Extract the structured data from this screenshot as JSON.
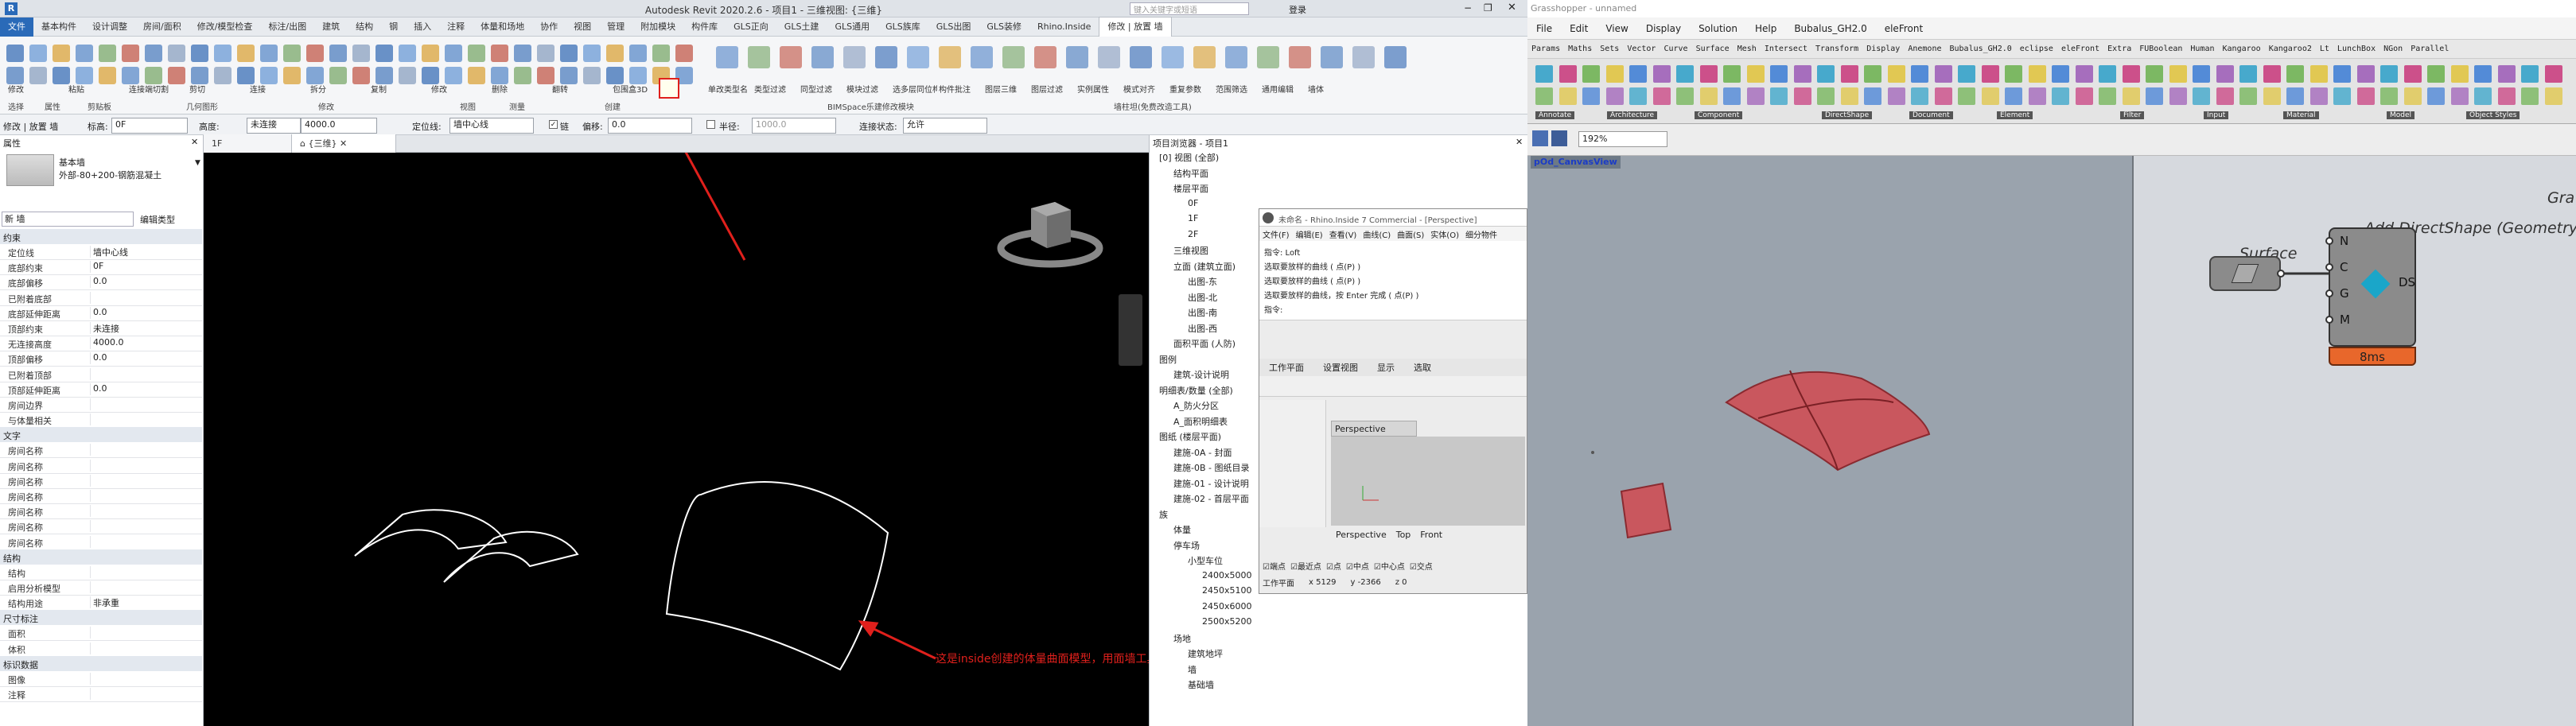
{
  "revit": {
    "title": "Autodesk Revit 2020.2.6 - 项目1 - 三维视图: {三维}",
    "search_placeholder": "键入关键字或短语",
    "user": "登录",
    "tabs": [
      "文件",
      "基本构件",
      "设计调整",
      "房间/面积",
      "修改/模型检查",
      "标注/出图",
      "建筑",
      "结构",
      "钢",
      "插入",
      "注释",
      "体量和场地",
      "协作",
      "视图",
      "管理",
      "附加模块",
      "构件库",
      "GLS正向",
      "GLS土建",
      "GLS通用",
      "GLS族库",
      "GLS出图",
      "GLS装修",
      "Rhino.Inside",
      "修改 | 放置 墙"
    ],
    "ribbon_groups": [
      "选择",
      "属性",
      "剪贴板",
      "几何图形",
      "修改",
      "视图",
      "测量",
      "创建",
      "BIMSpace乐建修改模块",
      "墙柱坦(免费改造工具)"
    ],
    "ribbon_labels": [
      "修改",
      "粘贴",
      "连接端切割",
      "剪切",
      "连接",
      "拆分",
      "复制",
      "修改",
      "删除",
      "翻转",
      "包围盒3D",
      "单改类型名",
      "类型过滤",
      "同型过滤",
      "模块过滤",
      "选多层同位构件",
      "构件批注",
      "图层三维",
      "图层过滤",
      "实例属性",
      "模式对齐",
      "重复参数",
      "范围筛选",
      "通用编辑",
      "墙体"
    ],
    "options": {
      "mode_label": "修改 | 放置 墙",
      "height_label": "高度:",
      "height_value": "未连接",
      "height_num": "4000.0",
      "locline_label": "定位线:",
      "locline_value": "墙中心线",
      "chain_label": "链",
      "offset_label": "偏移:",
      "offset_value": "0.0",
      "radius_label": "半径:",
      "radius_value": "1000.0",
      "join_label": "连接状态:",
      "join_value": "允许",
      "level_label": "标高:",
      "level_value": "0F"
    },
    "properties": {
      "header": "属性",
      "type_name": "基本墙",
      "type_sub": "外部-80+200-钢筋混凝土",
      "instance_filter": "新 墙",
      "edit_type": "编辑类型",
      "sections": [
        {
          "name": "约束",
          "rows": [
            [
              "定位线",
              "墙中心线"
            ],
            [
              "底部约束",
              "0F"
            ],
            [
              "底部偏移",
              "0.0"
            ],
            [
              "已附着底部",
              ""
            ],
            [
              "底部延伸距离",
              "0.0"
            ],
            [
              "顶部约束",
              "未连接"
            ],
            [
              "无连接高度",
              "4000.0"
            ],
            [
              "顶部偏移",
              "0.0"
            ],
            [
              "已附着顶部",
              ""
            ],
            [
              "顶部延伸距离",
              "0.0"
            ],
            [
              "房间边界",
              ""
            ],
            [
              "与体量相关",
              ""
            ]
          ]
        },
        {
          "name": "文字",
          "rows": [
            [
              "房间名称",
              ""
            ],
            [
              "房间名称",
              ""
            ],
            [
              "房间名称",
              ""
            ],
            [
              "房间名称",
              ""
            ],
            [
              "房间名称",
              ""
            ],
            [
              "房间名称",
              ""
            ],
            [
              "房间名称",
              ""
            ]
          ]
        },
        {
          "name": "结构",
          "rows": [
            [
              "结构",
              ""
            ],
            [
              "启用分析模型",
              ""
            ],
            [
              "结构用途",
              "非承重"
            ]
          ]
        },
        {
          "name": "尺寸标注",
          "rows": [
            [
              "面积",
              ""
            ],
            [
              "体积",
              ""
            ]
          ]
        },
        {
          "name": "标识数据",
          "rows": [
            [
              "图像",
              ""
            ],
            [
              "注释",
              ""
            ]
          ]
        }
      ]
    },
    "view_tabs": [
      "1F",
      "{三维}"
    ],
    "annotation": "这是inside创建的体量曲面模型，用面墙工具无法拾取生成为墙体",
    "browser": {
      "title": "项目浏览器 - 项目1",
      "items": [
        {
          "t": "[0] 视图 (全部)",
          "d": 0
        },
        {
          "t": "结构平面",
          "d": 1
        },
        {
          "t": "楼层平面",
          "d": 1
        },
        {
          "t": "0F",
          "d": 2
        },
        {
          "t": "1F",
          "d": 2
        },
        {
          "t": "2F",
          "d": 2
        },
        {
          "t": "三维视图",
          "d": 1
        },
        {
          "t": "立面 (建筑立面)",
          "d": 1
        },
        {
          "t": "出图-东",
          "d": 2
        },
        {
          "t": "出图-北",
          "d": 2
        },
        {
          "t": "出图-南",
          "d": 2
        },
        {
          "t": "出图-西",
          "d": 2
        },
        {
          "t": "面积平面 (人防)",
          "d": 1
        },
        {
          "t": "图例",
          "d": 0
        },
        {
          "t": "建筑-设计说明",
          "d": 1
        },
        {
          "t": "明细表/数量 (全部)",
          "d": 0
        },
        {
          "t": "A_防火分区",
          "d": 1
        },
        {
          "t": "A_面积明细表",
          "d": 1
        },
        {
          "t": "图纸 (楼层平面)",
          "d": 0
        },
        {
          "t": "建施-0A - 封面",
          "d": 1
        },
        {
          "t": "建施-0B - 图纸目录",
          "d": 1
        },
        {
          "t": "建施-01 - 设计说明",
          "d": 1
        },
        {
          "t": "建施-02 - 首层平面",
          "d": 1
        },
        {
          "t": "族",
          "d": 0
        },
        {
          "t": "体量",
          "d": 1
        },
        {
          "t": "停车场",
          "d": 1
        },
        {
          "t": "小型车位",
          "d": 2
        },
        {
          "t": "2400x5000",
          "d": 3
        },
        {
          "t": "2450x5100",
          "d": 3
        },
        {
          "t": "2450x6000",
          "d": 3
        },
        {
          "t": "2500x5200",
          "d": 3
        },
        {
          "t": "场地",
          "d": 1
        },
        {
          "t": "建筑地坪",
          "d": 2
        },
        {
          "t": "墙",
          "d": 2
        },
        {
          "t": "基础墙",
          "d": 2
        }
      ]
    }
  },
  "rhino": {
    "title": "未命名 - Rhino.Inside 7 Commercial - [Perspective]",
    "menu": [
      "文件(F)",
      "编辑(E)",
      "查看(V)",
      "曲线(C)",
      "曲面(S)",
      "实体(O)",
      "细分物件"
    ],
    "commands": [
      "指令: Loft",
      "选取要放样的曲线 ( 点(P) )",
      "选取要放样的曲线 ( 点(P) )",
      "选取要放样的曲线，按 Enter 完成 ( 点(P) )",
      "指令:"
    ],
    "tabs": [
      "工作平面",
      "设置视图",
      "显示",
      "选取"
    ],
    "viewport": "Perspective",
    "view_tabs": [
      "Perspective",
      "Top",
      "Front"
    ],
    "snaps": [
      "端点",
      "最近点",
      "点",
      "中点",
      "中心点",
      "交点"
    ],
    "status": [
      "工作平面",
      "x 5129",
      "y -2366",
      "z 0"
    ]
  },
  "gh": {
    "title": "Grasshopper - unnamed",
    "menu": [
      "File",
      "Edit",
      "View",
      "Display",
      "Solution",
      "Help",
      "Bubalus_GH2.0",
      "eleFront"
    ],
    "categories": [
      "Params",
      "Maths",
      "Sets",
      "Vector",
      "Curve",
      "Surface",
      "Mesh",
      "Intersect",
      "Transform",
      "Display",
      "Anemone",
      "Bubalus_GH2.0",
      "eclipse",
      "eleFront",
      "Extra",
      "FUBoolean",
      "Human",
      "Kangaroo",
      "Kangaroo2",
      "Lt",
      "LunchBox",
      "NGon",
      "Parallel"
    ],
    "panel_groups": [
      "Annotate",
      "Architecture",
      "Component",
      "DirectShape",
      "Document",
      "Element",
      "Filter",
      "Input",
      "Material",
      "Model",
      "Object Styles"
    ],
    "zoom": "192%",
    "viewport_label": "pOd_CanvasView",
    "canvas_title": "Add DirectShape (Geometry)",
    "canvas_partial": "Gra",
    "surface_label": "Surface",
    "inputs": [
      "N",
      "C",
      "G",
      "M"
    ],
    "output": "DS",
    "timing": "8ms"
  },
  "colors": {
    "revit_blue": "#2a6ab8",
    "annotation_red": "#e0201c",
    "gh_orange": "#e8672b",
    "surface_pink": "#c9575e"
  }
}
